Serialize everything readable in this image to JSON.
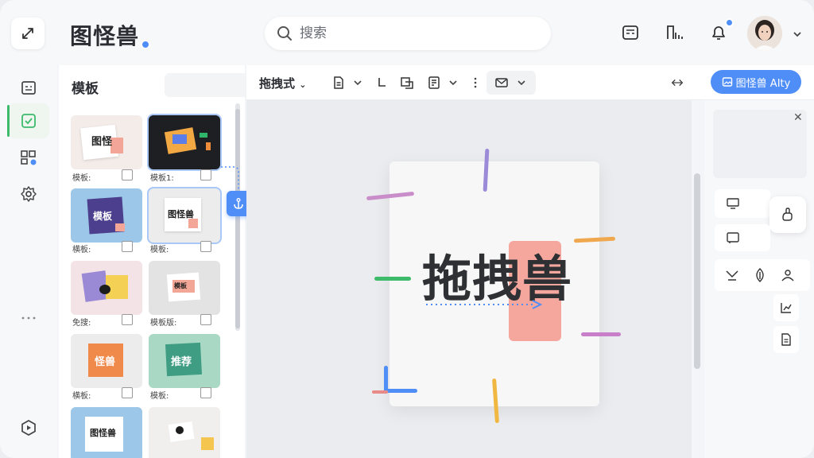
{
  "header": {
    "title": "图怪兽",
    "search_placeholder": "搜索"
  },
  "panel": {
    "title": "模板",
    "cards": [
      {
        "label": "模板:",
        "thumb": "图怪"
      },
      {
        "label": "模板1:",
        "thumb": ""
      },
      {
        "label": "横板:",
        "thumb": "模板"
      },
      {
        "label": "模板:",
        "thumb": "图怪兽"
      },
      {
        "label": "免搜:",
        "thumb": ""
      },
      {
        "label": "模板版:",
        "thumb": "模板"
      },
      {
        "label": "横板:",
        "thumb": "怪兽"
      },
      {
        "label": "模板:",
        "thumb": "推荐"
      },
      {
        "label": "",
        "thumb": "图怪兽"
      },
      {
        "label": "",
        "thumb": ""
      }
    ]
  },
  "toolbar": {
    "mode_label": "拖拽式",
    "primary_label": "图怪兽 AIty"
  },
  "canvas": {
    "main_text": "拖拽兽"
  },
  "colors": {
    "accent": "#4f8ef7",
    "active_green": "#3dbb6b",
    "sticky_pink": "#f48c80"
  }
}
